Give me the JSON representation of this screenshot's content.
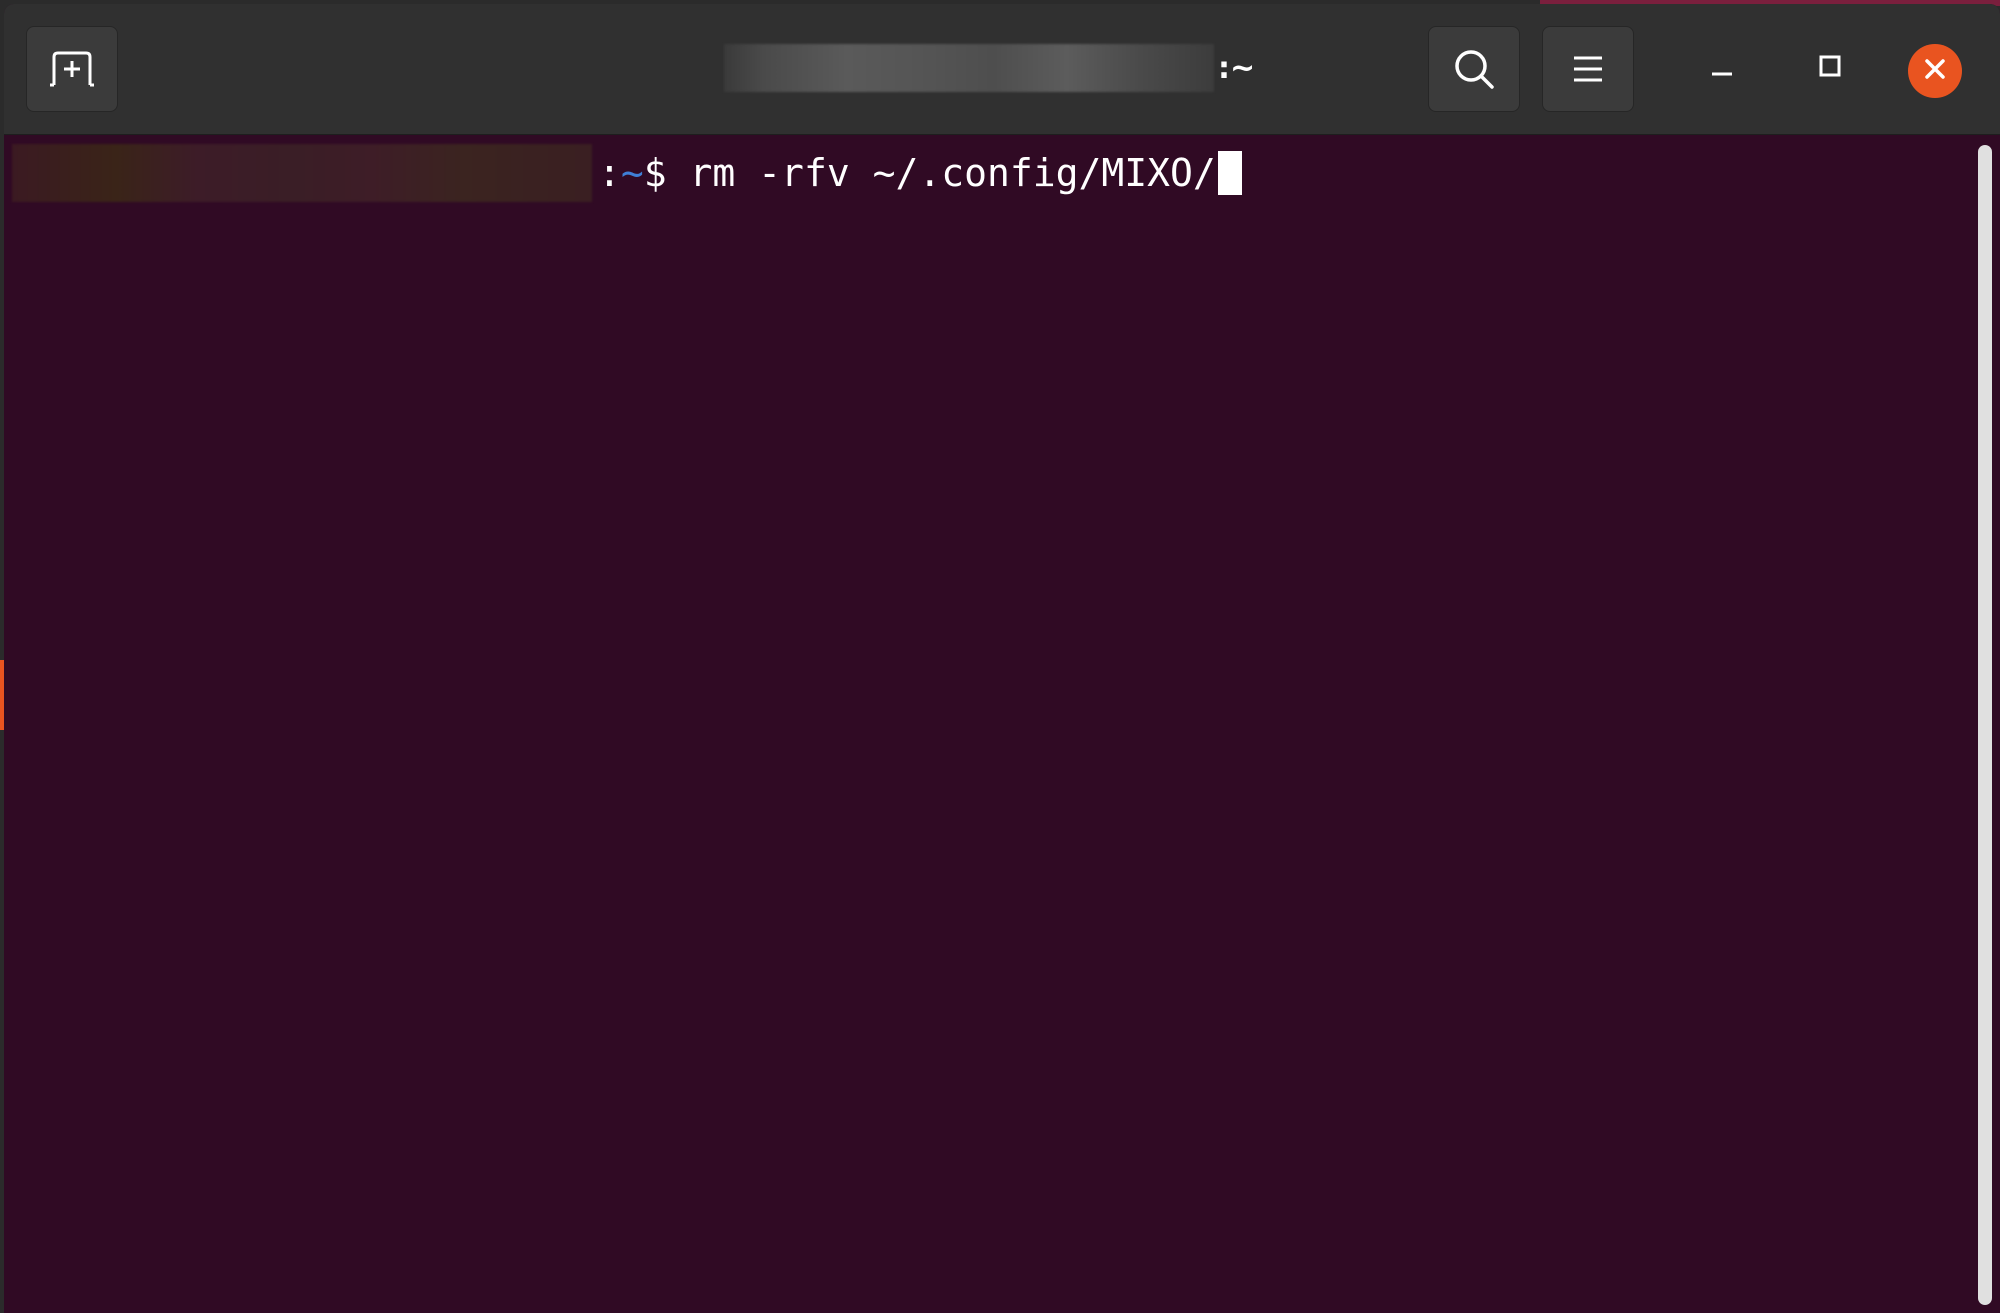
{
  "window": {
    "title_suffix": ":~"
  },
  "titlebar": {
    "new_tab_icon": "new-tab-icon",
    "search_icon": "search-icon",
    "menu_icon": "hamburger-menu-icon",
    "minimize_icon": "minimize-icon",
    "maximize_icon": "maximize-icon",
    "close_icon": "close-icon"
  },
  "terminal": {
    "prompt_colon": ":",
    "prompt_path": "~",
    "prompt_symbol": "$",
    "command": " rm -rfv ~/.config/MIXO/"
  },
  "colors": {
    "terminal_bg": "#300a24",
    "titlebar_bg": "#303030",
    "close_button": "#e95420",
    "prompt_path": "#3f7fd6"
  }
}
